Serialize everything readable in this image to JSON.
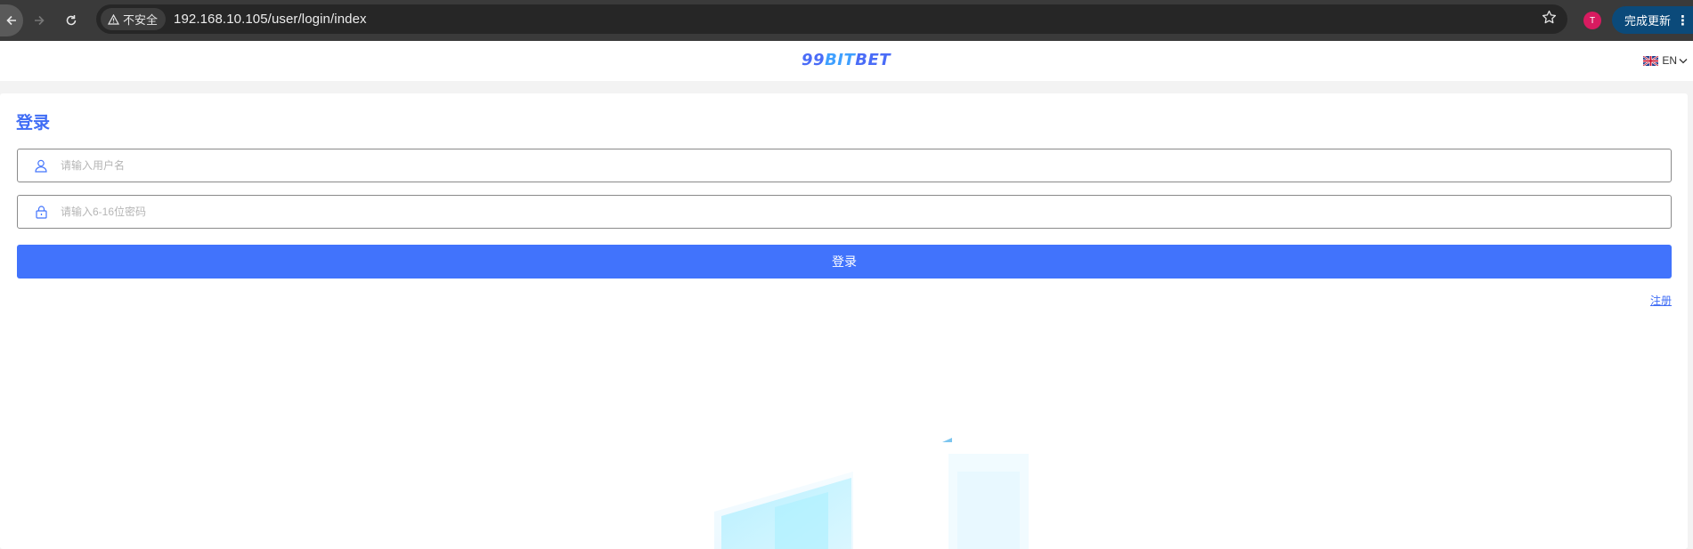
{
  "browser": {
    "security_label": "不安全",
    "url": "192.168.10.105/user/login/index",
    "profile_initial": "T",
    "update_label": "完成更新"
  },
  "header": {
    "logo_prefix": "99",
    "logo_bit": "BIT",
    "logo_suffix": "BET",
    "language": "EN"
  },
  "login": {
    "title": "登录",
    "username_placeholder": "请输入用户名",
    "password_placeholder": "请输入6-16位密码",
    "submit_label": "登录",
    "register_label": "注册"
  },
  "colors": {
    "accent": "#4173fc",
    "title": "#3f6cf5",
    "chrome": "#3a3a3a",
    "omnibox": "#262626",
    "update_button": "#0b4a7a",
    "profile": "#d81b60"
  },
  "icons": [
    "back-arrow-icon",
    "forward-arrow-icon",
    "reload-icon",
    "warning-icon",
    "star-icon",
    "kebab-menu-icon",
    "uk-flag-icon",
    "chevron-down-icon",
    "user-icon",
    "lock-icon"
  ]
}
